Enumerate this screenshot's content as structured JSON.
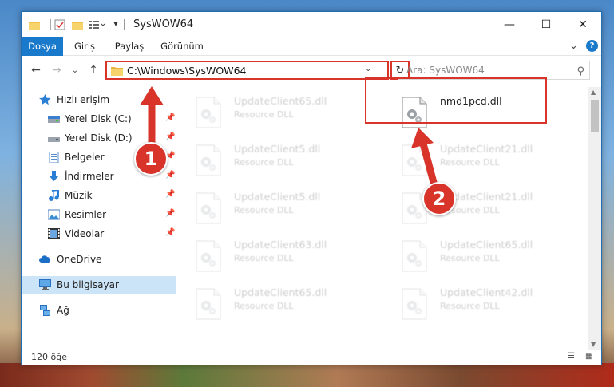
{
  "window": {
    "title": "SysWOW64"
  },
  "ribbon": {
    "tabs": [
      {
        "label": "Dosya",
        "active": true
      },
      {
        "label": "Giriş",
        "active": false
      },
      {
        "label": "Paylaş",
        "active": false
      },
      {
        "label": "Görünüm",
        "active": false
      }
    ]
  },
  "nav": {
    "address": "C:\\Windows\\SysWOW64",
    "search_placeholder": "Ara: SysWOW64"
  },
  "sidebar": {
    "items": [
      {
        "label": "Hızlı erişim",
        "icon": "star-icon"
      },
      {
        "label": "Yerel Disk (C:)",
        "icon": "drive-icon",
        "pinned": true
      },
      {
        "label": "Yerel Disk (D:)",
        "icon": "drive-icon",
        "pinned": true
      },
      {
        "label": "Belgeler",
        "icon": "documents-icon",
        "pinned": true
      },
      {
        "label": "İndirmeler",
        "icon": "download-icon",
        "pinned": true
      },
      {
        "label": "Müzik",
        "icon": "music-icon",
        "pinned": true
      },
      {
        "label": "Resimler",
        "icon": "pictures-icon",
        "pinned": true
      },
      {
        "label": "Videolar",
        "icon": "videos-icon",
        "pinned": true
      },
      {
        "label": "OneDrive",
        "icon": "cloud-icon"
      },
      {
        "label": "Bu bilgisayar",
        "icon": "computer-icon",
        "selected": true
      },
      {
        "label": "Ağ",
        "icon": "network-icon"
      }
    ]
  },
  "files": [
    {
      "name": "UpdateClient65.dll",
      "type": "Resource DLL"
    },
    {
      "name": "nmd1pcd.dll",
      "type": ""
    },
    {
      "name": "UpdateClient5.dll",
      "type": "Resource DLL"
    },
    {
      "name": "UpdateClient21.dll",
      "type": "Resource DLL"
    },
    {
      "name": "UpdateClient5.dll",
      "type": "Resource DLL"
    },
    {
      "name": "UpdateClient21.dll",
      "type": "Resource DLL"
    },
    {
      "name": "UpdateClient63.dll",
      "type": "Resource DLL"
    },
    {
      "name": "UpdateClient65.dll",
      "type": "Resource DLL"
    },
    {
      "name": "UpdateClient65.dll",
      "type": "Resource DLL"
    },
    {
      "name": "UpdateClient42.dll",
      "type": "Resource DLL"
    }
  ],
  "status": {
    "item_count": "120 öğe"
  },
  "annotations": {
    "step1": "1",
    "step2": "2"
  },
  "colors": {
    "accent": "#1979ca",
    "highlight": "#d8342a",
    "selected": "#cce4f7"
  }
}
